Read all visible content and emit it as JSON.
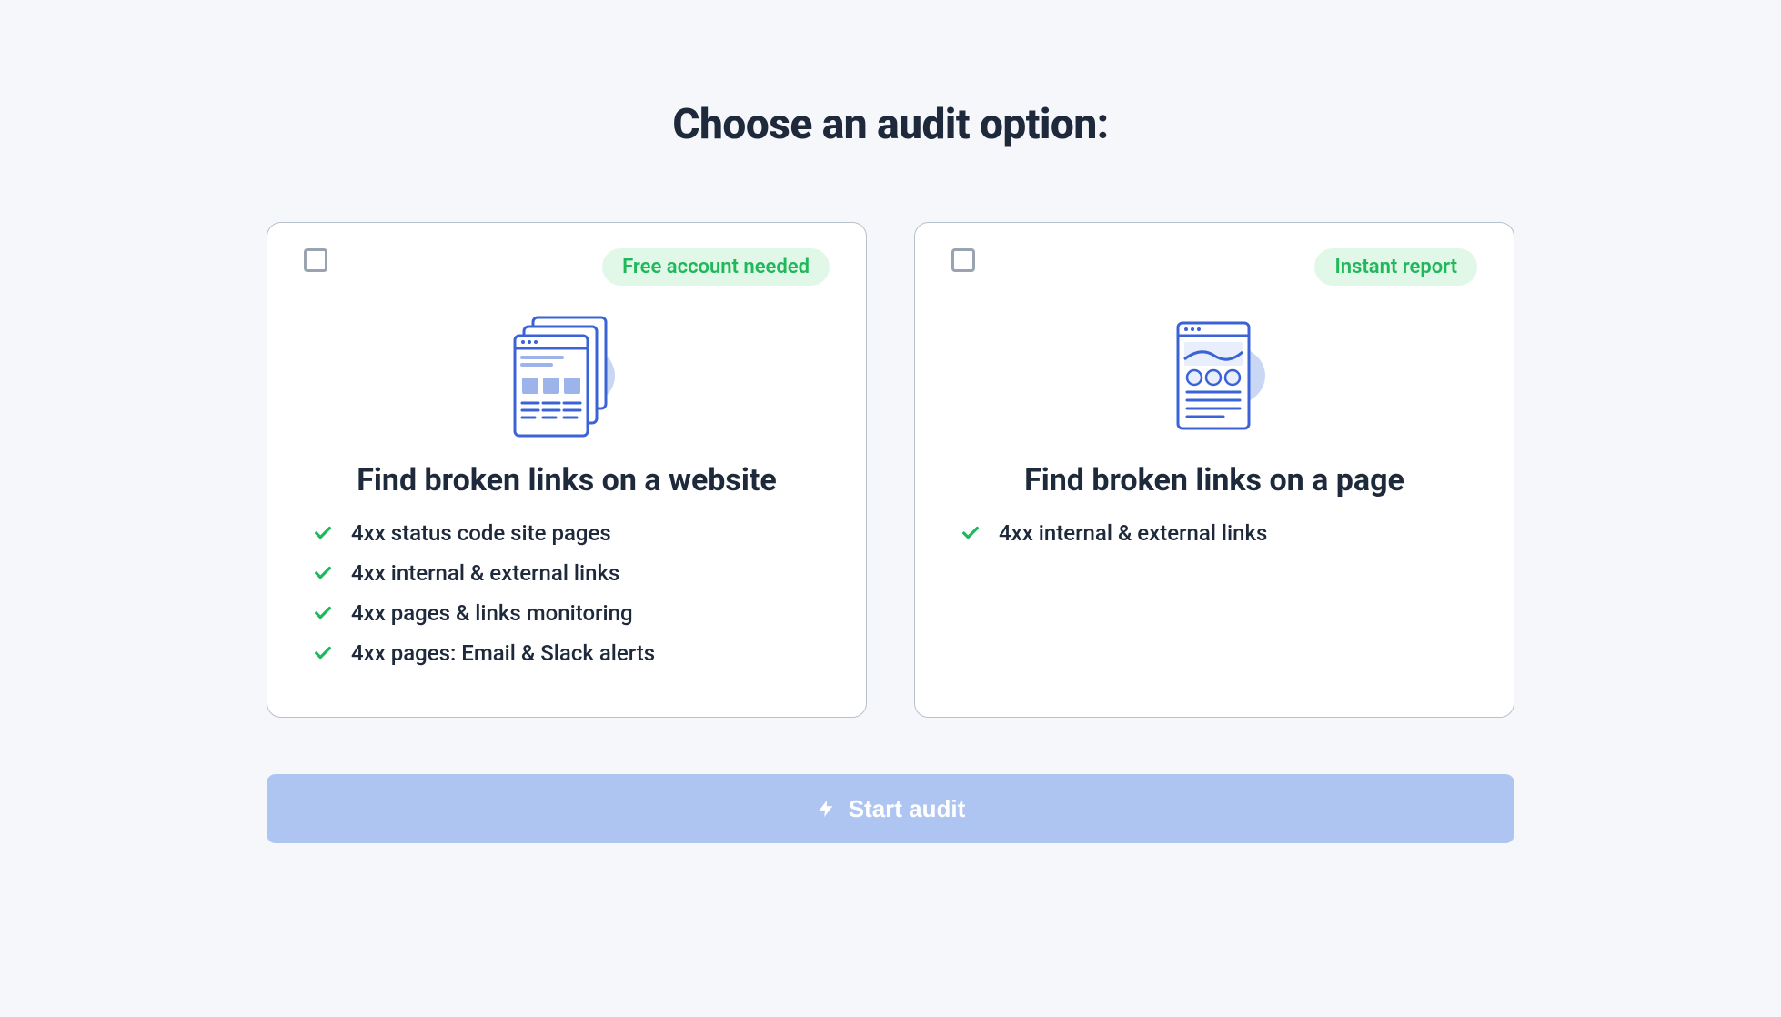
{
  "title": "Choose an audit option:",
  "cards": [
    {
      "badge": "Free account needed",
      "heading": "Find broken links on a website",
      "features": [
        "4xx status code site pages",
        "4xx internal & external links",
        "4xx pages & links monitoring",
        "4xx pages: Email & Slack alerts"
      ]
    },
    {
      "badge": "Instant report",
      "heading": "Find broken links on a page",
      "features": [
        "4xx internal & external links"
      ]
    }
  ],
  "button": "Start audit"
}
